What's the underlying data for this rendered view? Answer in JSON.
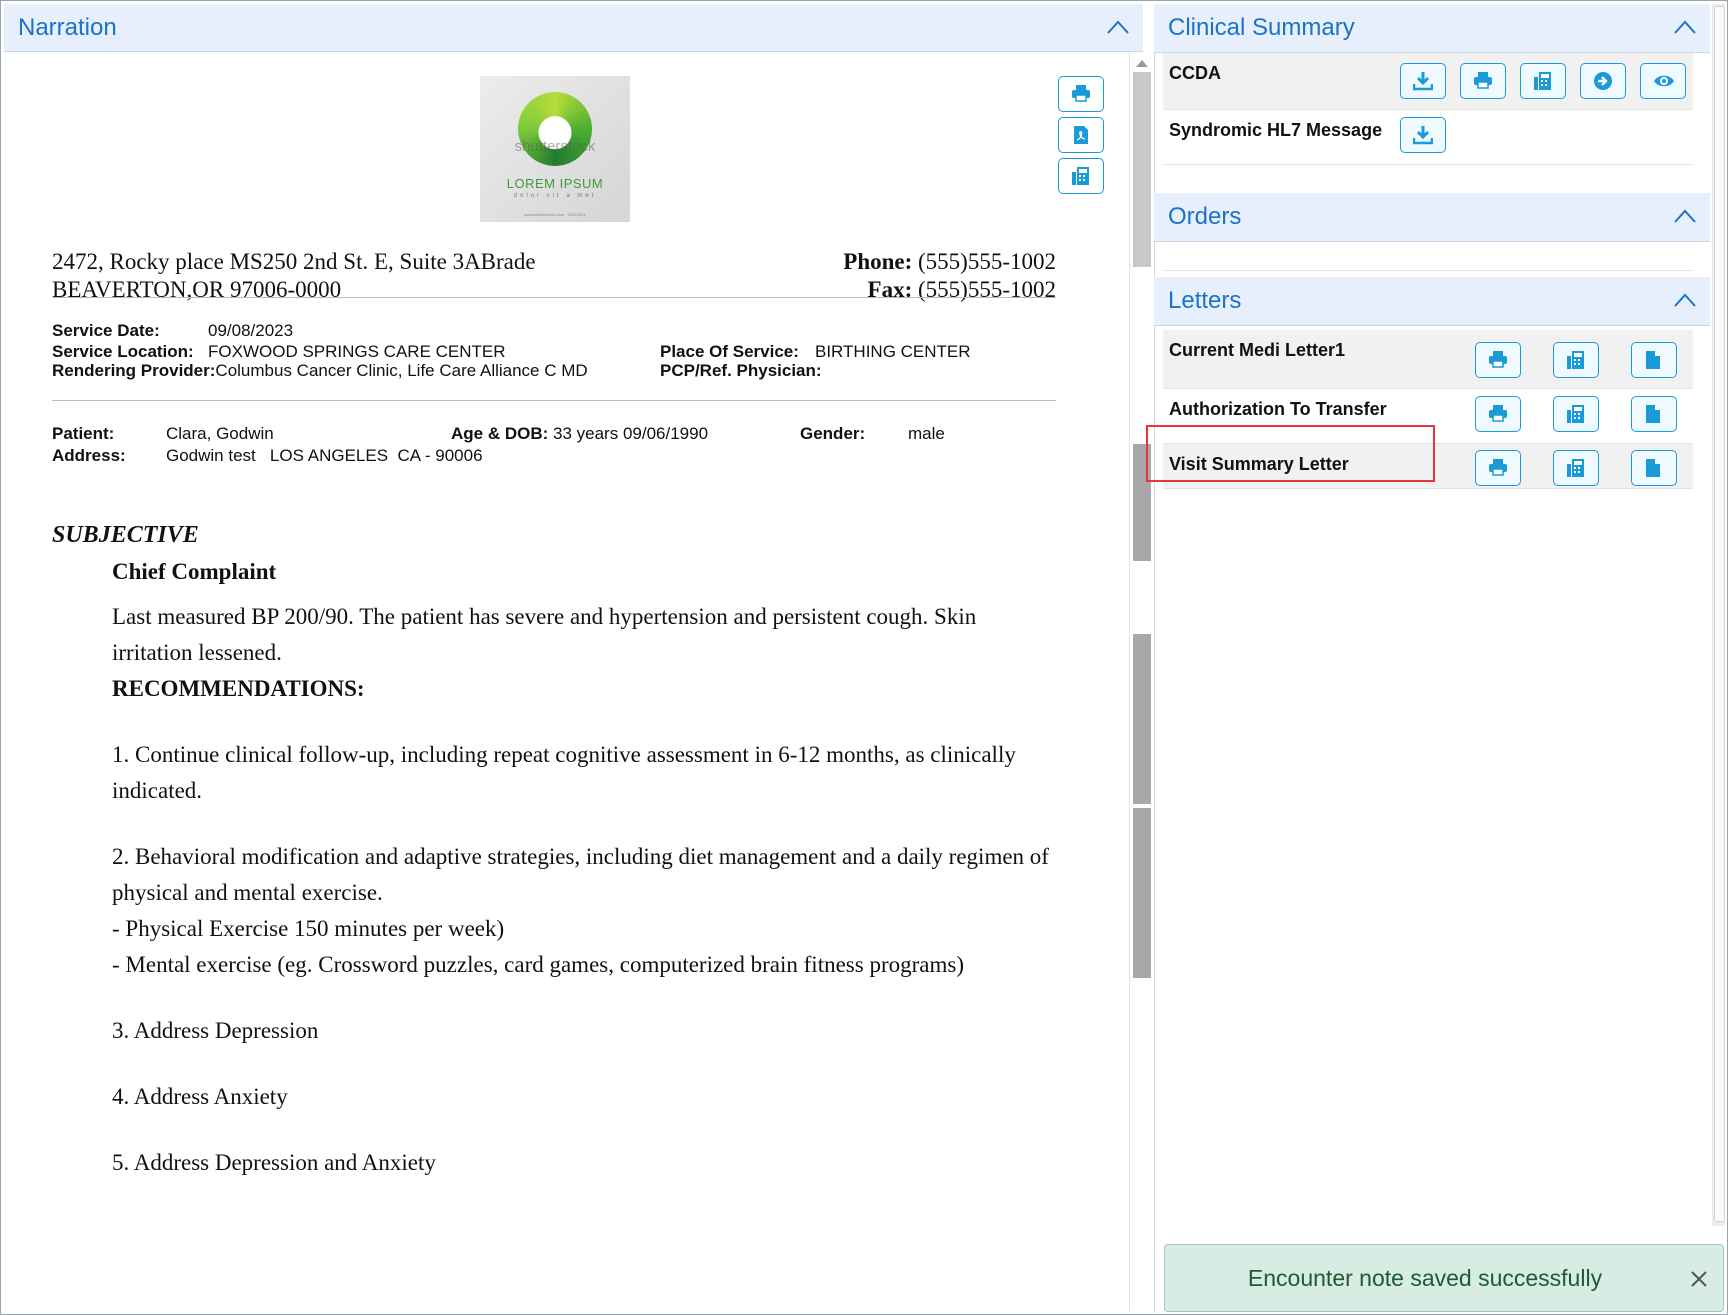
{
  "narration": {
    "title": "Narration",
    "logo": {
      "watermark": "shutterstock",
      "title": "LOREM IPSUM",
      "subtitle": "dolor sit a met",
      "url": "www.shutterstock.com · 91616024"
    },
    "doc_actions": [
      {
        "name": "print-icon",
        "label": "Print"
      },
      {
        "name": "pdf-icon",
        "label": "PDF"
      },
      {
        "name": "fax-icon",
        "label": "Fax"
      }
    ],
    "address": {
      "line1": "2472, Rocky place MS250 2nd St. E, Suite 3ABrade",
      "line2": "BEAVERTON,OR 97006-0000"
    },
    "contact": {
      "phone_label": "Phone:",
      "phone": "(555)555-1002",
      "fax_label": "Fax:",
      "fax": "(555)555-1002"
    },
    "service": {
      "date_label": "Service Date:",
      "date": "09/08/2023",
      "location_label": "Service Location:",
      "location": "FOXWOOD SPRINGS CARE CENTER",
      "provider_label": "Rendering Provider:",
      "provider": "Columbus Cancer Clinic, Life Care Alliance C  MD",
      "place_label": "Place Of Service:",
      "place": "BIRTHING CENTER",
      "pcp_label": "PCP/Ref. Physician:",
      "pcp": ""
    },
    "patient": {
      "patient_label": "Patient:",
      "name": "Clara, Godwin",
      "agedob_label": "Age & DOB:",
      "agedob": "33 years  09/06/1990",
      "gender_label": "Gender:",
      "gender": "male",
      "address_label": "Address:",
      "address": "Godwin test   LOS ANGELES  CA - 90006"
    },
    "section_title": "SUBJECTIVE",
    "chief_complaint_title": "Chief Complaint",
    "paragraphs": [
      "Last measured BP 200/90. The patient has severe and hypertension and persistent cough. Skin irritation lessened.",
      "RECOMMENDATIONS:",
      "",
      "1. Continue clinical follow-up, including repeat cognitive assessment in 6-12 months, as clinically indicated.",
      "",
      "2. Behavioral modification and adaptive strategies, including diet management and a daily regimen of physical and mental exercise.",
      "- Physical Exercise 150 minutes per week)",
      "- Mental exercise (eg. Crossword puzzles, card games, computerized brain fitness programs)",
      "",
      "3. Address Depression",
      "",
      "4. Address Anxiety",
      "",
      "5. Address Depression and Anxiety"
    ]
  },
  "clinical_summary": {
    "title": "Clinical Summary",
    "rows": [
      {
        "label": "CCDA",
        "actions": [
          "download-icon",
          "print-icon",
          "fax-icon",
          "forward-icon",
          "view-icon"
        ]
      },
      {
        "label": "Syndromic HL7 Message",
        "actions": [
          "download-icon"
        ]
      }
    ]
  },
  "orders": {
    "title": "Orders"
  },
  "letters": {
    "title": "Letters",
    "rows": [
      {
        "label": "Current Medi Letter1",
        "actions": [
          "print-icon",
          "fax-icon",
          "document-icon"
        ]
      },
      {
        "label": "Authorization To Transfer",
        "actions": [
          "print-icon",
          "fax-icon",
          "document-icon"
        ]
      },
      {
        "label": "Visit Summary Letter",
        "actions": [
          "print-icon",
          "fax-icon",
          "document-icon"
        ]
      }
    ]
  },
  "toast": {
    "message": "Encounter note saved successfully"
  },
  "colors": {
    "accent": "#1a73c9",
    "button_border": "#1a9ad7",
    "header_bg": "#e6effb",
    "highlight": "#e5373b",
    "toast_bg": "#d7ece3"
  }
}
